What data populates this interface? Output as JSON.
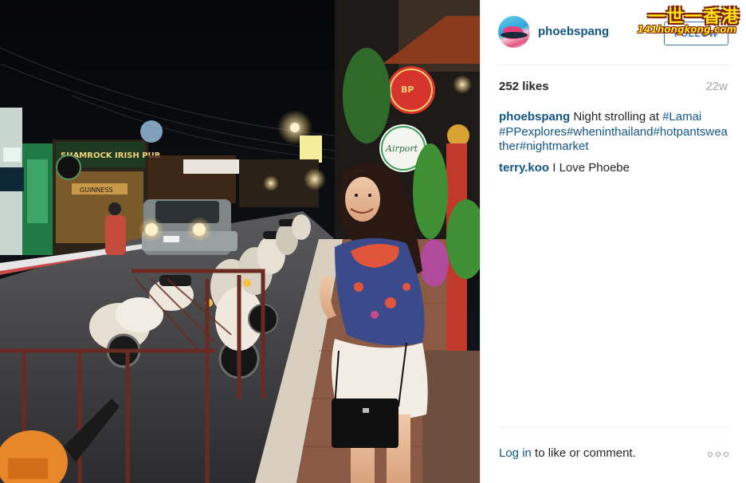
{
  "post": {
    "username": "phoebspang",
    "follow_label": "FOLLOW",
    "likes": "252 likes",
    "time_ago": "22w",
    "comments": [
      {
        "user": "phoebspang",
        "text_lead": "Night strolling at",
        "tags": [
          "#Lamai",
          "#PPexplores",
          "#wheninthailand",
          "#hotpantsweather",
          "#nightmarket"
        ]
      },
      {
        "user": "terry.koo",
        "text_lead": "I Love Phoebe",
        "tags": []
      }
    ],
    "login_link": "Log in",
    "login_suffix": "to like or comment.",
    "more_icon": "more-dots-icon"
  },
  "photo": {
    "sign_text": "SHAMROCK IRISH PUB",
    "sign_guinness": "GUINNESS",
    "sign_airport": "Airport"
  },
  "watermark": {
    "top": "一世一香港",
    "bottom": "141hongkong.com"
  },
  "colors": {
    "link": "#125688",
    "text": "#262626",
    "muted": "#a5a7aa",
    "follow_border": "#3f729b"
  }
}
